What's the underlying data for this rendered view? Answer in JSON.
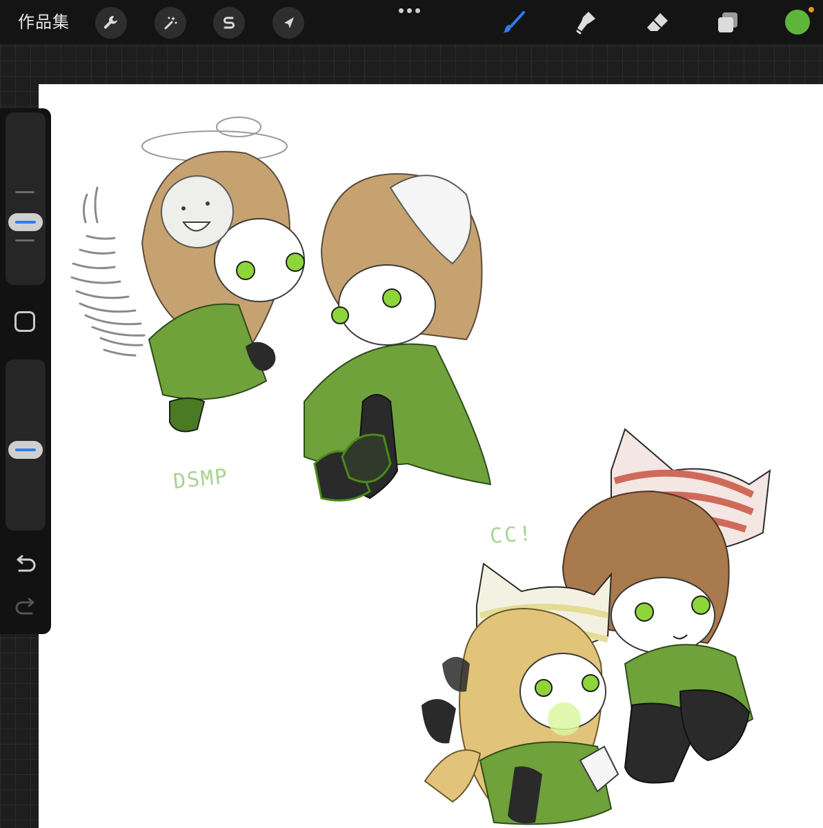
{
  "topbar": {
    "gallery_label": "作品集",
    "left_tools": [
      {
        "icon": "wrench-icon",
        "name": "actions"
      },
      {
        "icon": "magic-wand-icon",
        "name": "adjustments"
      },
      {
        "icon": "selection-s-icon",
        "name": "selection"
      },
      {
        "icon": "arrow-cursor-icon",
        "name": "transform"
      }
    ],
    "right_tools": [
      {
        "icon": "brush-icon",
        "name": "paint",
        "active": true,
        "color": "#2f7cf2"
      },
      {
        "icon": "smudge-icon",
        "name": "smudge"
      },
      {
        "icon": "eraser-icon",
        "name": "eraser"
      },
      {
        "icon": "layers-icon",
        "name": "layers"
      }
    ],
    "more_icon": "more-dots-icon",
    "current_color": "#5db53a",
    "notification_color": "#e8912d"
  },
  "sidebar": {
    "size_slider_icon": "brush-size-slider",
    "modify_button_icon": "square-modify-icon",
    "opacity_slider_icon": "brush-opacity-slider",
    "undo_icon": "undo-arrow-icon",
    "redo_icon": "redo-arrow-icon",
    "accent_color": "#2f7cf2"
  },
  "canvas": {
    "background": "#ffffff",
    "labels": {
      "dsmp": "DSMP",
      "cc": "CC!"
    },
    "label_color": "#a6d58f",
    "artwork": {
      "description_icon": "chibi-drawing-artwork",
      "main_colors": [
        "#6fa23a",
        "#c7a271",
        "#a87a4e",
        "#f2f2f2",
        "#b9c9a8",
        "#cf6a5a",
        "#2a2a2a"
      ]
    }
  }
}
